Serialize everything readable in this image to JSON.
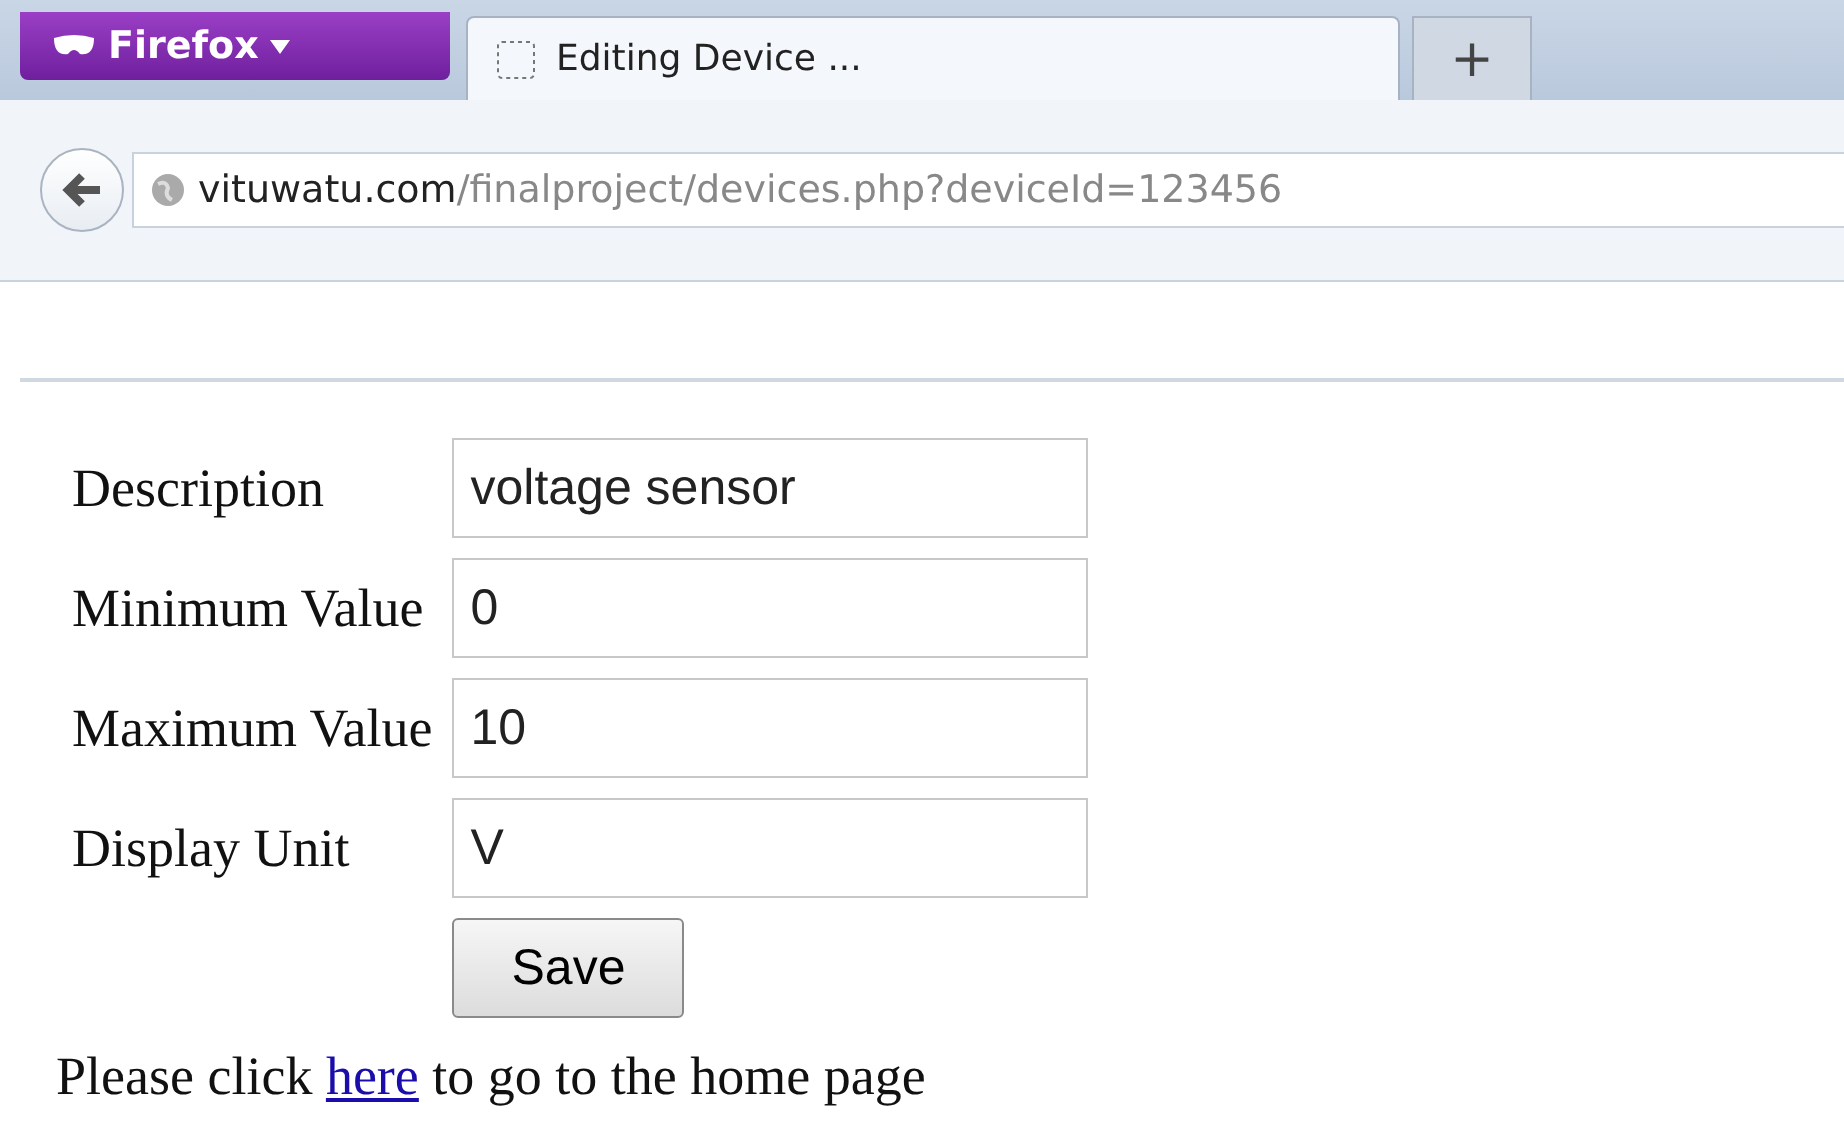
{
  "browser": {
    "menu_button": "Firefox",
    "tabs": [
      {
        "title": "Editing Device ...",
        "selected": true
      }
    ],
    "new_tab_button": "+",
    "address": {
      "domain": "vituwatu.com",
      "path": "/finalproject/devices.php?deviceId=123456"
    }
  },
  "form": {
    "fields": [
      {
        "label": "Description",
        "value": "voltage sensor"
      },
      {
        "label": "Minimum Value",
        "value": "0"
      },
      {
        "label": "Maximum Value",
        "value": "10"
      },
      {
        "label": "Display Unit",
        "value": "V"
      }
    ],
    "submit": "Save"
  },
  "footer": {
    "before": "Please click ",
    "link": "here",
    "after": " to go to the home page"
  }
}
